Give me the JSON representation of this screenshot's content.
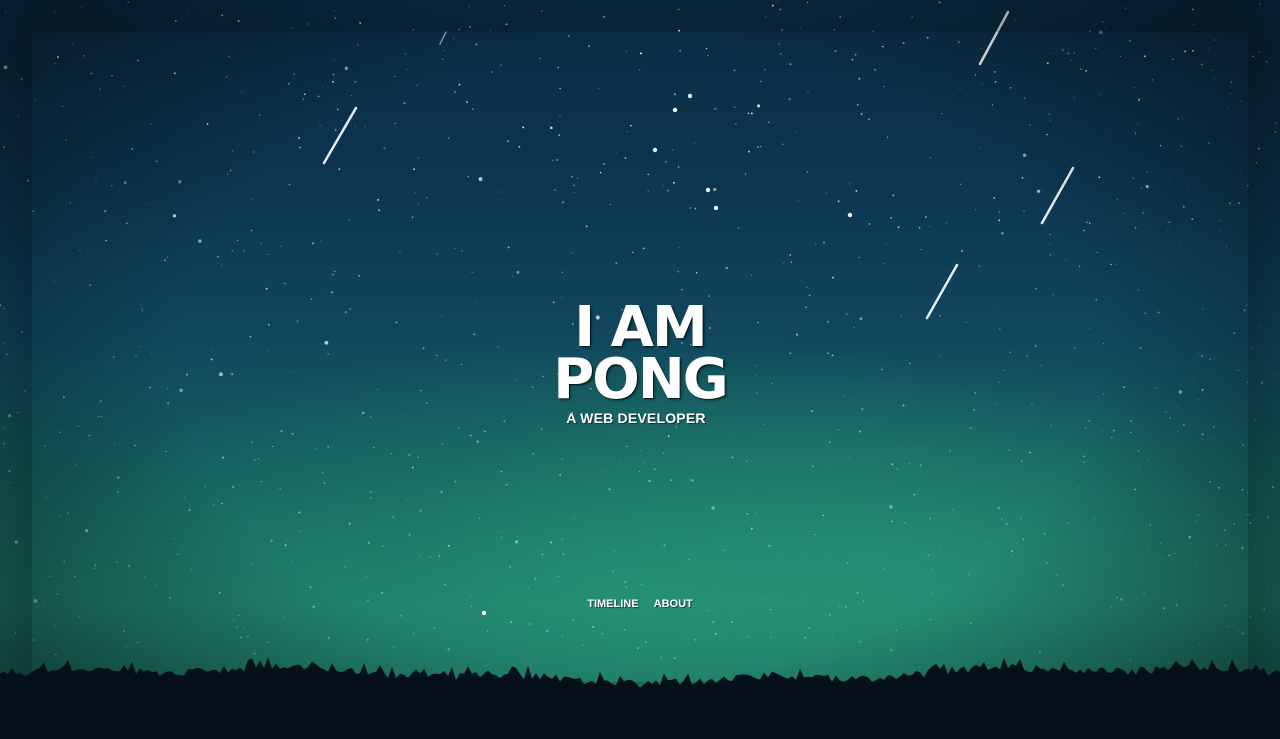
{
  "hero": {
    "line1": "I AM",
    "line2": "PONG",
    "subtitle": "A WEB DEVELOPER"
  },
  "nav": {
    "items": [
      {
        "label": "TIMELINE"
      },
      {
        "label": "ABOUT"
      }
    ]
  },
  "colors": {
    "sky_top": "#0a2b44",
    "sky_bottom": "#1e7766",
    "treeline": "#06101a",
    "text": "#ffffff"
  }
}
